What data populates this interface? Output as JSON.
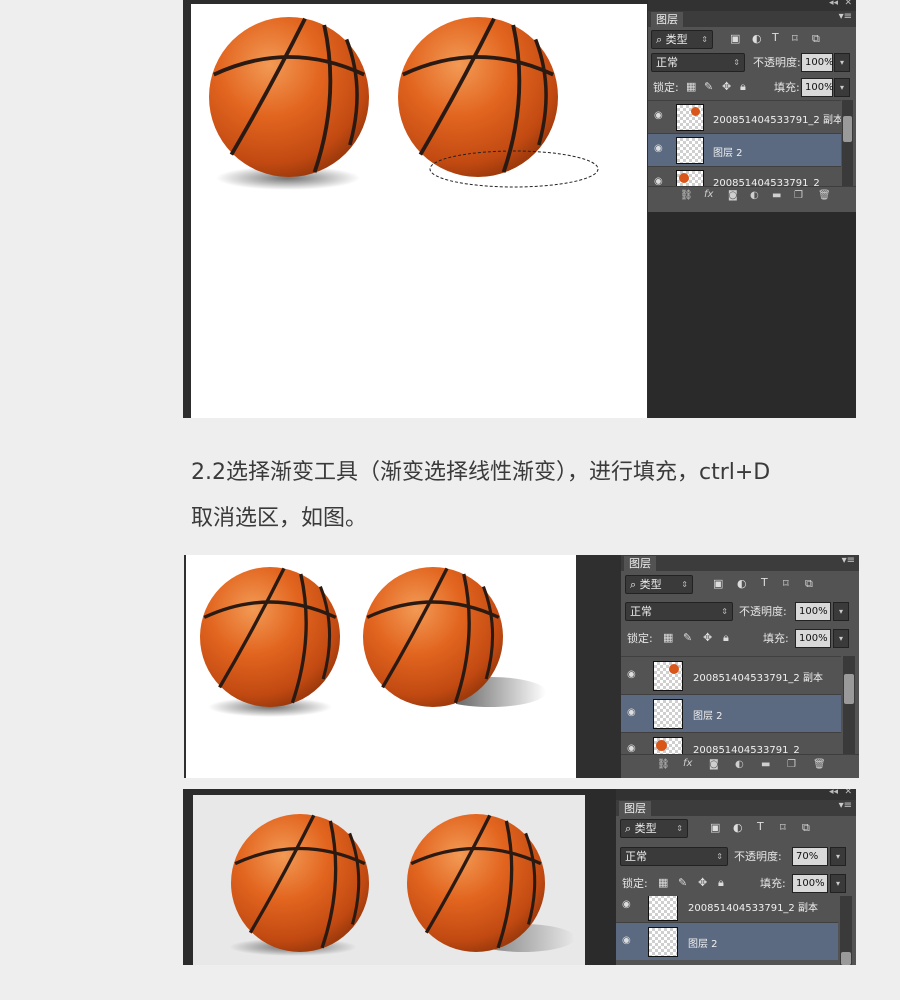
{
  "caption": {
    "line1": "2.2选择渐变工具（渐变选择线性渐变），进行填充，ctrl+D",
    "line2": "取消选区，如图。"
  },
  "panel1": {
    "tab": "图层",
    "kind_label": "类型",
    "blend_mode": "正常",
    "opacity_label": "不透明度:",
    "opacity_value": "100%",
    "lock_label": "锁定:",
    "fill_label": "填充:",
    "fill_value": "100%",
    "layers": [
      {
        "name": "200851404533791_2 副本"
      },
      {
        "name": "图层 2"
      },
      {
        "name": "200851404533791_2"
      }
    ]
  },
  "panel2": {
    "tab": "图层",
    "kind_label": "类型",
    "blend_mode": "正常",
    "opacity_label": "不透明度:",
    "opacity_value": "100%",
    "lock_label": "锁定:",
    "fill_label": "填充:",
    "fill_value": "100%",
    "layers": [
      {
        "name": "200851404533791_2 副本"
      },
      {
        "name": "图层 2"
      },
      {
        "name": "200851404533791_2"
      }
    ]
  },
  "panel3": {
    "tab": "图层",
    "kind_label": "类型",
    "blend_mode": "正常",
    "opacity_label": "不透明度:",
    "opacity_value": "70%",
    "lock_label": "锁定:",
    "fill_label": "填充:",
    "fill_value": "100%",
    "layers": [
      {
        "name": "200851404533791_2 副本"
      },
      {
        "name": "图层 2"
      }
    ]
  },
  "icons": {
    "eye": "eye-icon",
    "search": "search-icon",
    "link": "link-icon",
    "fx": "fx-icon",
    "mask": "mask-icon",
    "adjustment": "adjustment-icon",
    "folder": "folder-icon",
    "new_layer": "new-layer-icon",
    "trash": "trash-icon"
  },
  "colors": {
    "ball": "#e0601f",
    "selected_layer": "#5b6a80",
    "panel_bg": "#535353"
  }
}
